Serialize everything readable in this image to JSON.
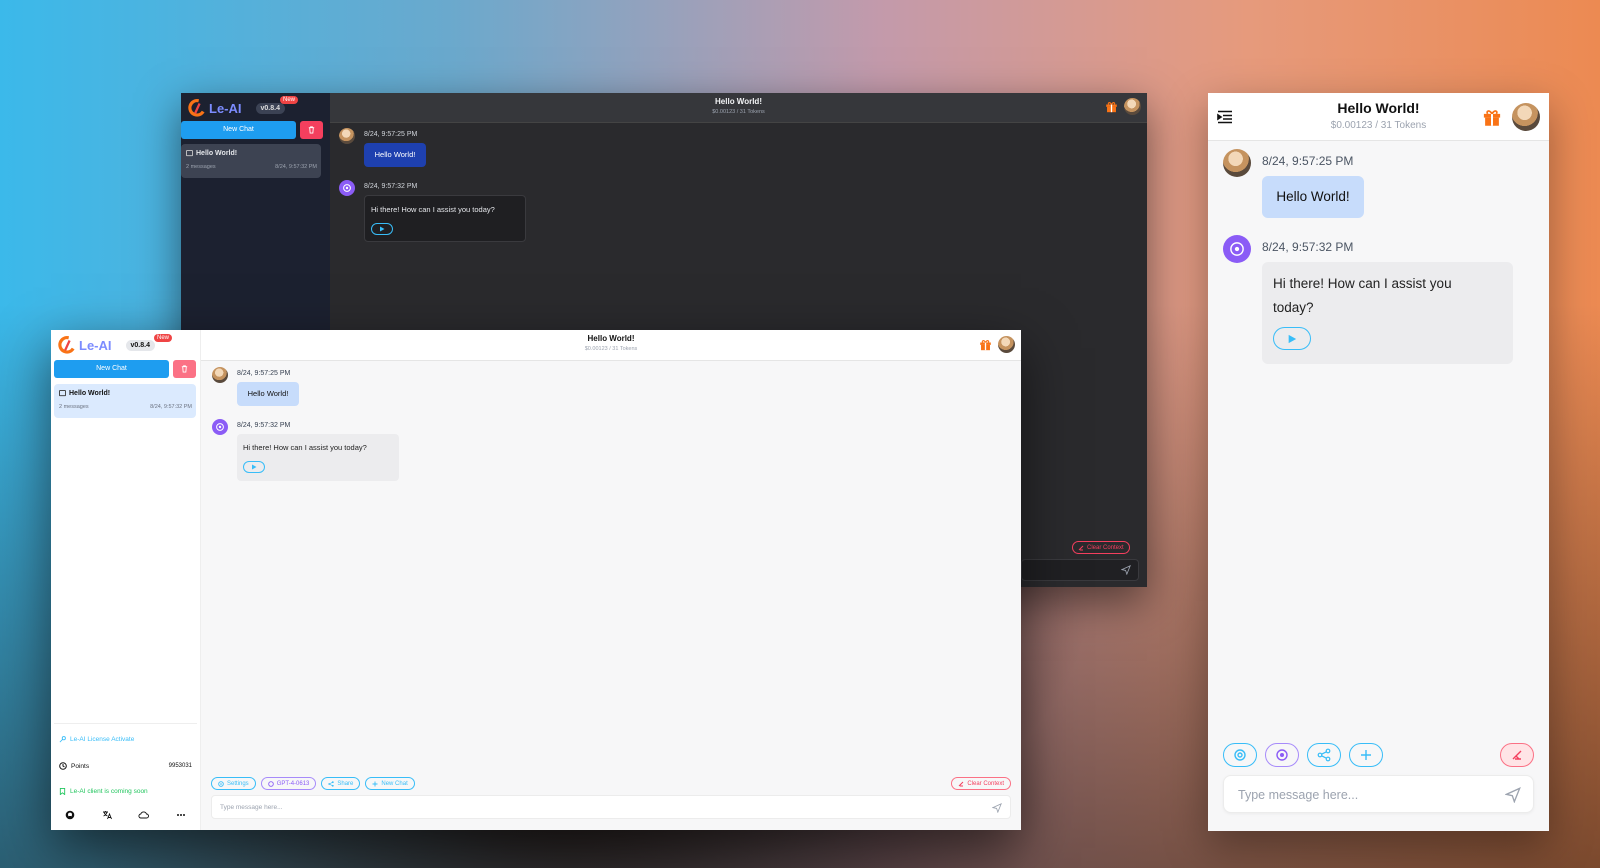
{
  "app": {
    "brand": "Le-AI",
    "version": "v0.8.4",
    "badge": "New"
  },
  "sidebar": {
    "new_chat": "New Chat",
    "conversation": {
      "title": "Hello World!",
      "count": "2 messages",
      "time": "8/24, 9:57:32 PM"
    },
    "license": "Le-AI License Activate",
    "points_label": "Points",
    "points_value": "9953031",
    "client_notice": "Le-AI client is coming soon",
    "footer_icons": [
      "github-icon",
      "translate-icon",
      "cloud-icon",
      "more-icon"
    ]
  },
  "header": {
    "title": "Hello World!",
    "subtitle": "$0.00123 / 31 Tokens"
  },
  "messages": [
    {
      "role": "user",
      "time": "8/24, 9:57:25 PM",
      "text": "Hello World!"
    },
    {
      "role": "assistant",
      "time": "8/24, 9:57:32 PM",
      "text": "Hi there! How can I assist you today?"
    }
  ],
  "toolbar": {
    "settings": "Settings",
    "model": "GPT-4-0613",
    "share": "Share",
    "new_chat": "New Chat",
    "clear": "Clear Context"
  },
  "input": {
    "placeholder": "Type message here..."
  },
  "colors": {
    "accent": "#38bdf8",
    "brand": "#7c8cff",
    "danger": "#f43f5e",
    "gift": "#f97316",
    "bot": "#8b5cf6"
  }
}
